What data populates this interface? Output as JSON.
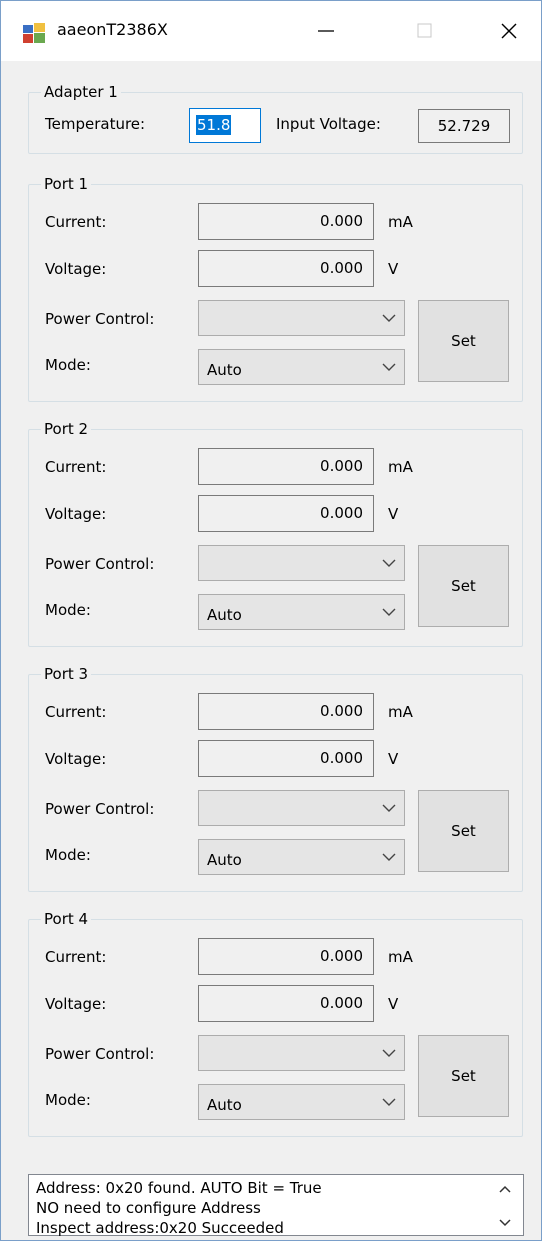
{
  "window": {
    "title": "aaeonT2386X"
  },
  "adapter": {
    "legend": "Adapter 1",
    "temperature_label": "Temperature:",
    "temperature_value": "51.8",
    "input_voltage_label": "Input Voltage:",
    "input_voltage_value": "52.729"
  },
  "ports": [
    {
      "legend": "Port 1",
      "current_label": "Current:",
      "current_value": "0.000",
      "current_unit": "mA",
      "voltage_label": "Voltage:",
      "voltage_value": "0.000",
      "voltage_unit": "V",
      "power_label": "Power Control:",
      "power_value": "",
      "mode_label": "Mode:",
      "mode_value": "Auto",
      "set_label": "Set"
    },
    {
      "legend": "Port 2",
      "current_label": "Current:",
      "current_value": "0.000",
      "current_unit": "mA",
      "voltage_label": "Voltage:",
      "voltage_value": "0.000",
      "voltage_unit": "V",
      "power_label": "Power Control:",
      "power_value": "",
      "mode_label": "Mode:",
      "mode_value": "Auto",
      "set_label": "Set"
    },
    {
      "legend": "Port 3",
      "current_label": "Current:",
      "current_value": "0.000",
      "current_unit": "mA",
      "voltage_label": "Voltage:",
      "voltage_value": "0.000",
      "voltage_unit": "V",
      "power_label": "Power Control:",
      "power_value": "",
      "mode_label": "Mode:",
      "mode_value": "Auto",
      "set_label": "Set"
    },
    {
      "legend": "Port 4",
      "current_label": "Current:",
      "current_value": "0.000",
      "current_unit": "mA",
      "voltage_label": "Voltage:",
      "voltage_value": "0.000",
      "voltage_unit": "V",
      "power_label": "Power Control:",
      "power_value": "",
      "mode_label": "Mode:",
      "mode_value": "Auto",
      "set_label": "Set"
    }
  ],
  "log": {
    "lines": [
      "Address: 0x20 found. AUTO Bit = True",
      "NO need to configure Address",
      "Inspect address:0x20 Succeeded"
    ]
  },
  "colors": {
    "selection": "#0078d7",
    "border": "#7a7a7a",
    "combo_bg": "#e5e5e5",
    "button_bg": "#e1e1e1"
  },
  "icons": {
    "app": "app-icon",
    "minimize": "minimize-icon",
    "maximize": "maximize-icon",
    "close": "close-icon",
    "dropdown": "chevron-down-icon"
  }
}
